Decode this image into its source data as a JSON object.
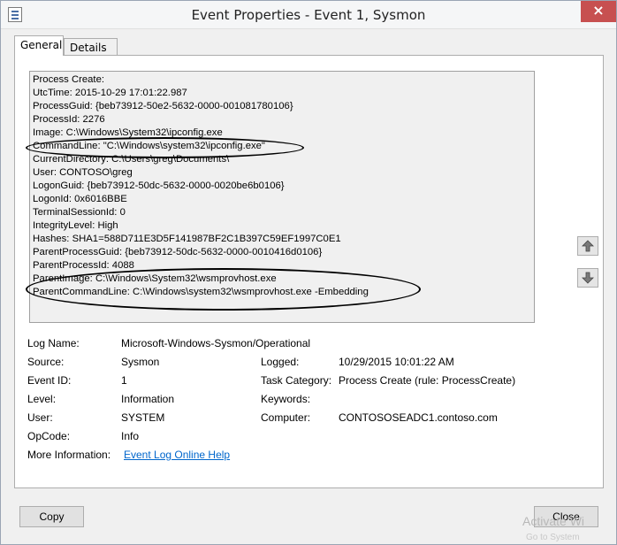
{
  "window": {
    "title": "Event Properties - Event 1, Sysmon",
    "close_label": "×"
  },
  "tabs": [
    {
      "label": "General",
      "active": true
    },
    {
      "label": "Details",
      "active": false
    }
  ],
  "description_lines": [
    "Process Create:",
    "UtcTime: 2015-10-29 17:01:22.987",
    "ProcessGuid: {beb73912-50e2-5632-0000-001081780106}",
    "ProcessId: 2276",
    "Image: C:\\Windows\\System32\\ipconfig.exe",
    "CommandLine: \"C:\\Windows\\system32\\ipconfig.exe\"",
    "CurrentDirectory: C:\\Users\\greg\\Documents\\",
    "User: CONTOSO\\greg",
    "LogonGuid: {beb73912-50dc-5632-0000-0020be6b0106}",
    "LogonId: 0x6016BBE",
    "TerminalSessionId: 0",
    "IntegrityLevel: High",
    "Hashes: SHA1=588D711E3D5F141987BF2C1B397C59EF1997C0E1",
    "ParentProcessGuid: {beb73912-50dc-5632-0000-0010416d0106}",
    "ParentProcessId: 4088",
    "ParentImage: C:\\Windows\\System32\\wsmprovhost.exe",
    "ParentCommandLine: C:\\Windows\\system32\\wsmprovhost.exe -Embedding"
  ],
  "fields": {
    "log_name_label": "Log Name:",
    "log_name_value": "Microsoft-Windows-Sysmon/Operational",
    "source_label": "Source:",
    "source_value": "Sysmon",
    "logged_label": "Logged:",
    "logged_value": "10/29/2015 10:01:22 AM",
    "event_id_label": "Event ID:",
    "event_id_value": "1",
    "task_category_label": "Task Category:",
    "task_category_value": "Process Create (rule: ProcessCreate)",
    "level_label": "Level:",
    "level_value": "Information",
    "keywords_label": "Keywords:",
    "keywords_value": "",
    "user_label": "User:",
    "user_value": "SYSTEM",
    "computer_label": "Computer:",
    "computer_value": "CONTOSOSEADC1.contoso.com",
    "opcode_label": "OpCode:",
    "opcode_value": "Info",
    "more_info_label": "More Information:",
    "more_info_link": "Event Log Online Help"
  },
  "buttons": {
    "copy": "Copy",
    "close": "Close"
  },
  "watermark": {
    "line1": "Activate Wi",
    "line2": "Go to System"
  }
}
